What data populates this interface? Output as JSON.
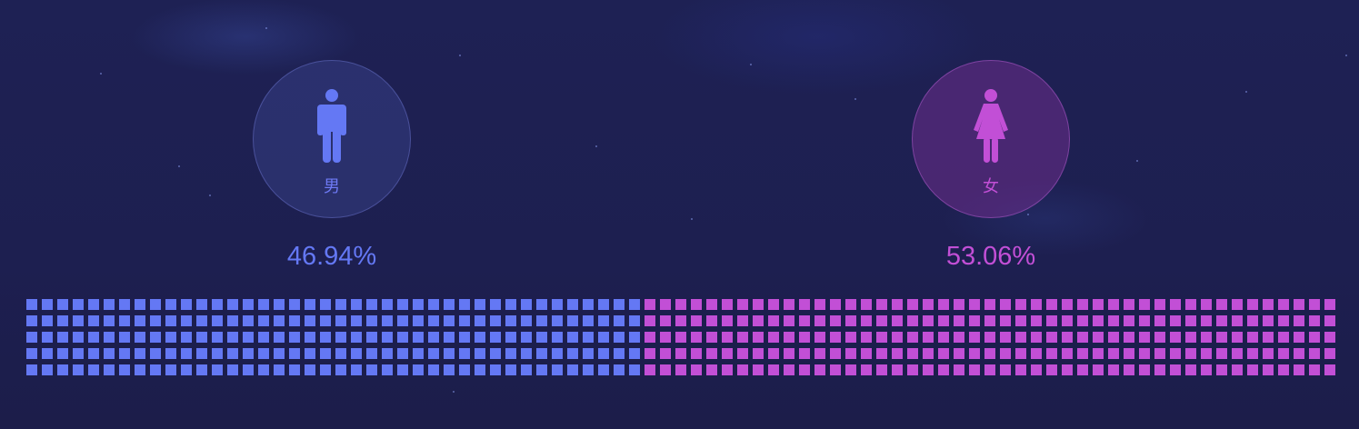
{
  "male": {
    "label": "男",
    "percent": "46.94%",
    "fraction": 0.4694,
    "color": "#6478f4",
    "icon": "male-figure-icon"
  },
  "female": {
    "label": "女",
    "percent": "53.06%",
    "fraction": 0.5306,
    "color": "#c24fd6",
    "icon": "female-figure-icon"
  },
  "chart_data": {
    "type": "waffle",
    "categories": [
      "男",
      "女"
    ],
    "values": [
      46.94,
      53.06
    ],
    "colors": [
      "#6478f4",
      "#c24fd6"
    ]
  }
}
